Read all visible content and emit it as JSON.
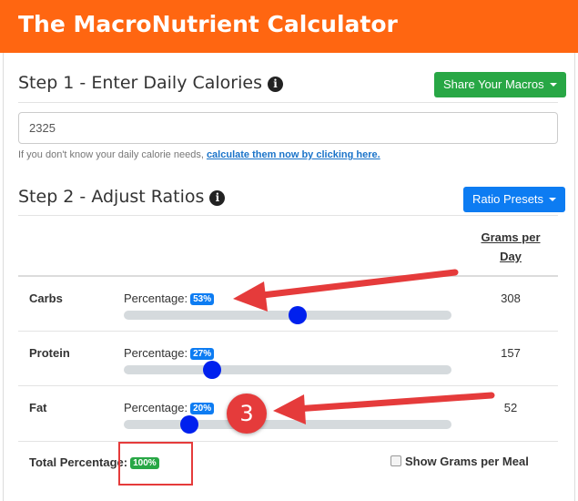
{
  "header": {
    "title": "The MacroNutrient Calculator"
  },
  "step1": {
    "title": "Step 1 - Enter Daily Calories",
    "info_icon_glyph": "i",
    "share_button": "Share Your Macros",
    "calories_value": "2325",
    "helper_text": "If you don't know your daily calorie needs, ",
    "helper_link": "calculate them now by clicking here."
  },
  "step2": {
    "title": "Step 2 - Adjust Ratios",
    "info_icon_glyph": "i",
    "presets_button": "Ratio Presets",
    "grams_header_line1": "Grams per",
    "grams_header_line2": "Day",
    "percentage_label": "Percentage:",
    "rows": [
      {
        "name": "Carbs",
        "percent_text": "53%",
        "percent": 53,
        "grams": "308"
      },
      {
        "name": "Protein",
        "percent_text": "27%",
        "percent": 27,
        "grams": "157"
      },
      {
        "name": "Fat",
        "percent_text": "20%",
        "percent": 20,
        "grams": "52"
      }
    ],
    "total_label": "Total Percentage:",
    "total_value": "100%",
    "show_grams_label": "Show Grams per Meal",
    "show_grams_checked": false
  },
  "annotation": {
    "step_number": "3"
  },
  "colors": {
    "header": "#ff6611",
    "green": "#28a745",
    "blue": "#0d7cf2",
    "slider_thumb": "#0020ee",
    "annotation_red": "#e53b3b"
  }
}
